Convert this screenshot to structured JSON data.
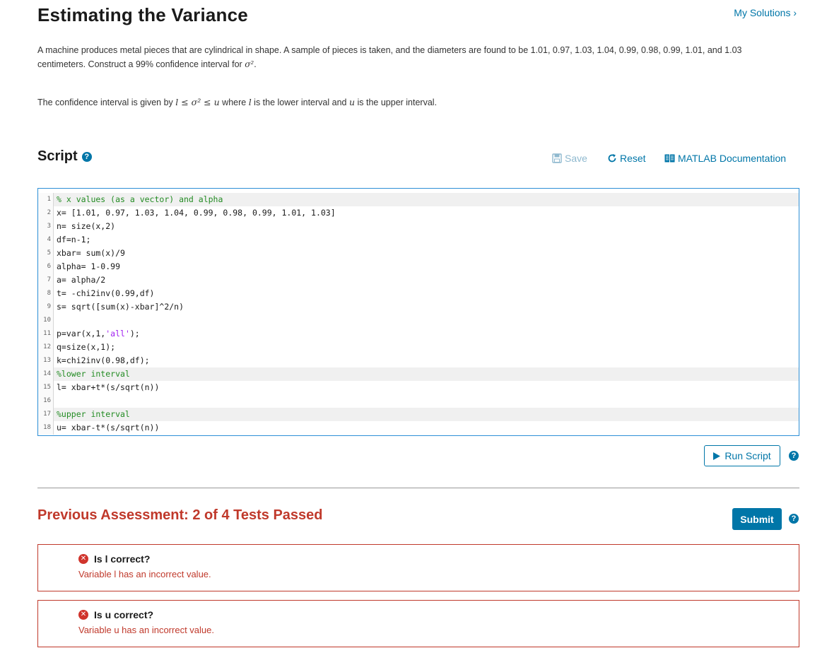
{
  "page": {
    "title": "Estimating the Variance",
    "my_solutions": "My Solutions ›"
  },
  "problem": {
    "text": "A machine produces metal pieces that are cylindrical in shape. A sample of pieces is taken, and the diameters are found to be 1.01, 0.97, 1.03, 1.04, 0.99, 0.98, 0.99, 1.01, and 1.03 centimeters. Construct a 99% confidence interval for ",
    "sigma": "σ²",
    "end": ".",
    "ci_prefix": "The confidence interval is given by ",
    "ci_formula": "l ≤ σ² ≤ u",
    "ci_mid1": " where ",
    "ci_l": "l",
    "ci_mid2": " is the lower interval and ",
    "ci_u": "u",
    "ci_suffix": " is the upper interval."
  },
  "script": {
    "heading": "Script",
    "help": "?",
    "save_label": "Save",
    "reset_label": "Reset",
    "doc_label": "MATLAB Documentation",
    "lines": [
      {
        "n": "1",
        "text": "% x values (as a vector) and alpha",
        "comment": true
      },
      {
        "n": "2",
        "text": "x= [1.01, 0.97, 1.03, 1.04, 0.99, 0.98, 0.99, 1.01, 1.03]",
        "comment": false
      },
      {
        "n": "3",
        "text": "n= size(x,2)",
        "comment": false
      },
      {
        "n": "4",
        "text": "df=n-1;",
        "comment": false
      },
      {
        "n": "5",
        "text": "xbar= sum(x)/9",
        "comment": false
      },
      {
        "n": "6",
        "text": "alpha= 1-0.99",
        "comment": false
      },
      {
        "n": "7",
        "text": "a= alpha/2",
        "comment": false
      },
      {
        "n": "8",
        "text": "t= -chi2inv(0.99,df)",
        "comment": false
      },
      {
        "n": "9",
        "text": "s= sqrt([sum(x)-xbar]^2/n)",
        "comment": false
      },
      {
        "n": "10",
        "text": "",
        "comment": false
      },
      {
        "n": "11",
        "text": "p=var(x,1,'all');",
        "comment": false
      },
      {
        "n": "12",
        "text": "q=size(x,1);",
        "comment": false
      },
      {
        "n": "13",
        "text": "k=chi2inv(0.98,df);",
        "comment": false
      },
      {
        "n": "14",
        "text": "%lower interval",
        "comment": true
      },
      {
        "n": "15",
        "text": "l= xbar+t*(s/sqrt(n))",
        "comment": false
      },
      {
        "n": "16",
        "text": "",
        "comment": false
      },
      {
        "n": "17",
        "text": "%upper interval",
        "comment": true
      },
      {
        "n": "18",
        "text": "u= xbar-t*(s/sqrt(n))",
        "comment": false
      }
    ],
    "highlighted": [
      "1",
      "14",
      "17"
    ],
    "run_label": "Run Script"
  },
  "assessment": {
    "heading": "Previous Assessment: 2 of 4 Tests Passed",
    "submit_label": "Submit",
    "tests": [
      {
        "title": "Is l correct?",
        "message": "Variable l has an incorrect value."
      },
      {
        "title": "Is u correct?",
        "message": "Variable u has an incorrect value."
      }
    ]
  },
  "colors": {
    "accent": "#0076a8",
    "error": "#c0392b",
    "comment": "#228b22",
    "string": "#a020f0"
  }
}
